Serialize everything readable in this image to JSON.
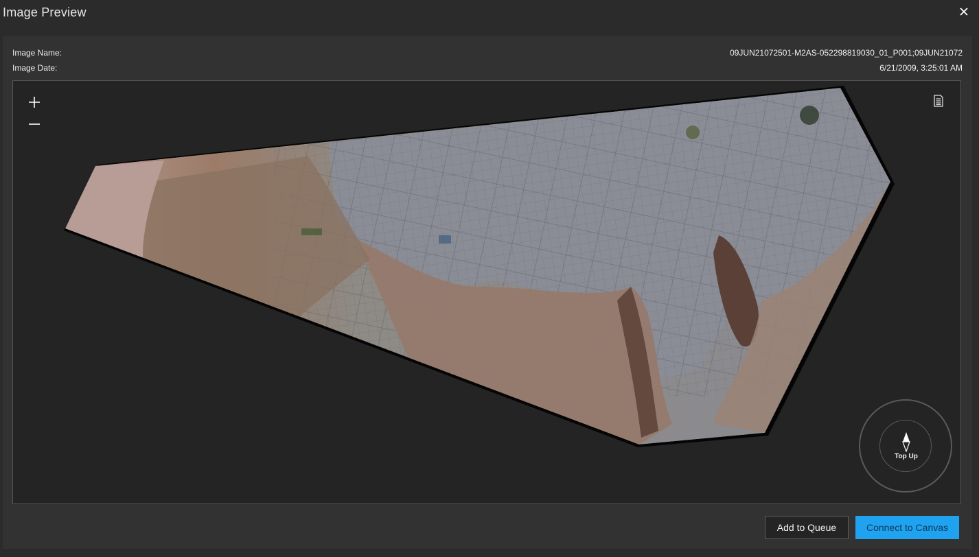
{
  "dialog": {
    "title": "Image Preview",
    "close_icon": "close-icon"
  },
  "meta": {
    "name_label": "Image Name:",
    "name_value": "09JUN21072501-M2AS-052298819030_01_P001;09JUN21072",
    "date_label": "Image Date:",
    "date_value": "6/21/2009, 3:25:01 AM"
  },
  "viewer": {
    "zoom_in_icon": "plus-icon",
    "zoom_out_icon": "minus-icon",
    "legend_icon": "document-icon",
    "compass_label": "Top Up",
    "colors": {
      "background": "#242424",
      "urban": "#8d8f98",
      "desert": "#9a7f70",
      "mountain": "#6a4c40"
    }
  },
  "actions": {
    "add_to_queue": "Add to Queue",
    "connect_to_canvas": "Connect to Canvas",
    "accent_color": "#1fa3f0"
  }
}
